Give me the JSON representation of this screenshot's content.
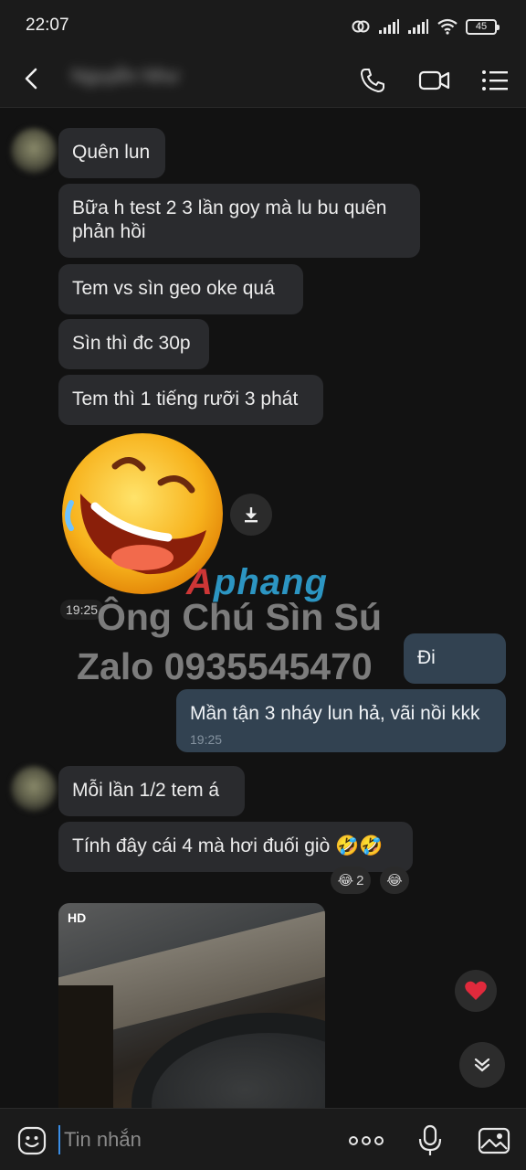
{
  "status_bar": {
    "time": "22:07",
    "battery": "45"
  },
  "header": {
    "contact_name": "Nguyễn Như"
  },
  "messages": [
    {
      "text": "Quên lun"
    },
    {
      "text": "Bữa h test 2 3 lần goy mà lu bu quên phản hồi"
    },
    {
      "text": "Tem vs sìn geo oke quá"
    },
    {
      "text": "Sìn thì đc 30p"
    },
    {
      "text": "Tem thì 1 tiếng rưỡi 3 phát"
    },
    {
      "sticker_time": "19:25"
    },
    {
      "text": "Đi"
    },
    {
      "text": "Mần tận 3 nháy lun hả, vãi nồi kkk",
      "time": "19:25"
    },
    {
      "text": "Mỗi lần 1/2 tem á"
    },
    {
      "text": "Tính đây cái 4 mà hơi đuối giò 🤣🤣",
      "reactions": [
        {
          "emoji": "😂",
          "count": "2"
        },
        {
          "emoji": "😂"
        }
      ]
    },
    {
      "video_badge": "HD"
    }
  ],
  "watermark": {
    "logo_a": "A",
    "logo_rest": "phang",
    "line1": "Ông Chú Sìn Sú",
    "line2": "Zalo 0935545470"
  },
  "input": {
    "placeholder": "Tin nhắn"
  },
  "icons": {
    "back": "back-arrow-icon",
    "call": "phone-icon",
    "video_call": "video-camera-icon",
    "menu": "list-menu-icon",
    "download": "download-icon",
    "heart": "heart-icon",
    "scroll_down": "chevron-double-down-icon",
    "emoji": "emoji-icon",
    "more": "more-dots-icon",
    "mic": "microphone-icon",
    "image": "image-icon"
  },
  "colors": {
    "incoming_bubble": "#2a2b2e",
    "outgoing_bubble": "#324251",
    "heart": "#e02a3c",
    "logo_blue": "#2fa4d6",
    "logo_red": "#e23a3a"
  }
}
